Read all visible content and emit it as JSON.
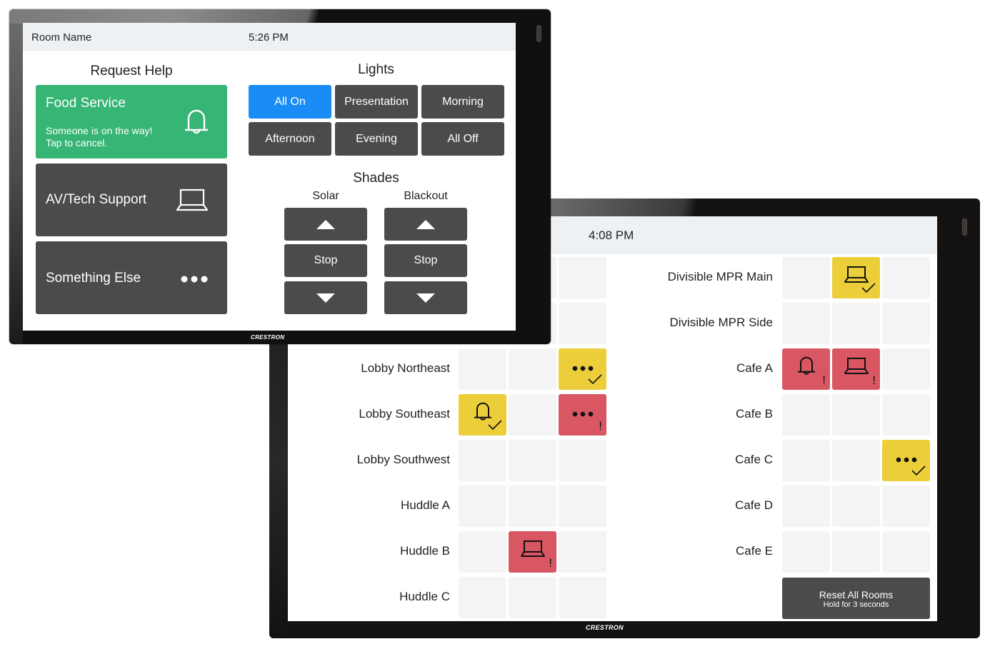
{
  "brand_logo": "CRESTRON",
  "room_panel": {
    "status": {
      "room_name": "Room Name",
      "time": "5:26 PM"
    },
    "request_help": {
      "title": "Request Help",
      "cards": [
        {
          "label": "Food Service",
          "subtitle": "Someone is on the way!\nTap to cancel.",
          "icon": "bell-icon",
          "state": "active",
          "color": "#36b574"
        },
        {
          "label": "AV/Tech Support",
          "subtitle": "",
          "icon": "laptop-icon",
          "state": "idle",
          "color": "#4b4b4b"
        },
        {
          "label": "Something Else",
          "subtitle": "",
          "icon": "more-dots-icon",
          "state": "idle",
          "color": "#4b4b4b"
        }
      ]
    },
    "lights": {
      "title": "Lights",
      "buttons": [
        {
          "label": "All On",
          "active": true
        },
        {
          "label": "Presentation",
          "active": false
        },
        {
          "label": "Morning",
          "active": false
        },
        {
          "label": "Afternoon",
          "active": false
        },
        {
          "label": "Evening",
          "active": false
        },
        {
          "label": "All Off",
          "active": false
        }
      ],
      "active_color": "#1a8cf5"
    },
    "shades": {
      "title": "Shades",
      "groups": [
        {
          "label": "Solar",
          "up": "up-arrow-icon",
          "stop": "Stop",
          "down": "down-arrow-icon"
        },
        {
          "label": "Blackout",
          "up": "up-arrow-icon",
          "stop": "Stop",
          "down": "down-arrow-icon"
        }
      ]
    }
  },
  "monitor_panel": {
    "status": {
      "time": "4:08 PM"
    },
    "status_colors": {
      "acknowledged": "#ecce3a",
      "pending": "#d95663",
      "empty": "#f4f4f4"
    },
    "left_column": [
      {
        "room": "",
        "cells": [
          "empty",
          "empty",
          "empty"
        ],
        "partially_hidden": true
      },
      {
        "room": "",
        "cells": [
          "empty",
          "empty",
          "empty"
        ],
        "partially_hidden": true
      },
      {
        "room": "Lobby Northeast",
        "cells": [
          null,
          null,
          {
            "icon": "more-dots-icon",
            "status": "acknowledged",
            "badge": "✓"
          }
        ]
      },
      {
        "room": "Lobby Southeast",
        "cells": [
          {
            "icon": "bell-icon",
            "status": "acknowledged",
            "badge": "✓"
          },
          null,
          {
            "icon": "more-dots-icon",
            "status": "pending",
            "badge": "!"
          }
        ]
      },
      {
        "room": "Lobby Southwest",
        "cells": [
          null,
          null,
          null
        ]
      },
      {
        "room": "Huddle A",
        "cells": [
          null,
          null,
          null
        ]
      },
      {
        "room": "Huddle B",
        "cells": [
          null,
          {
            "icon": "laptop-icon",
            "status": "pending",
            "badge": "!"
          },
          null
        ]
      },
      {
        "room": "Huddle C",
        "cells": [
          null,
          null,
          null
        ]
      }
    ],
    "right_column": [
      {
        "room": "Divisible MPR Main",
        "cells": [
          null,
          {
            "icon": "laptop-icon",
            "status": "acknowledged",
            "badge": "✓"
          },
          null
        ]
      },
      {
        "room": "Divisible MPR Side",
        "cells": [
          null,
          null,
          null
        ]
      },
      {
        "room": "Cafe A",
        "cells": [
          {
            "icon": "bell-icon",
            "status": "pending",
            "badge": "!"
          },
          {
            "icon": "laptop-icon",
            "status": "pending",
            "badge": "!"
          },
          null
        ]
      },
      {
        "room": "Cafe B",
        "cells": [
          null,
          null,
          null
        ]
      },
      {
        "room": "Cafe C",
        "cells": [
          null,
          null,
          {
            "icon": "more-dots-icon",
            "status": "acknowledged",
            "badge": "✓"
          }
        ]
      },
      {
        "room": "Cafe D",
        "cells": [
          null,
          null,
          null
        ]
      },
      {
        "room": "Cafe E",
        "cells": [
          null,
          null,
          null
        ]
      }
    ],
    "reset_button": {
      "label": "Reset All Rooms",
      "hint": "Hold for 3 seconds"
    }
  }
}
